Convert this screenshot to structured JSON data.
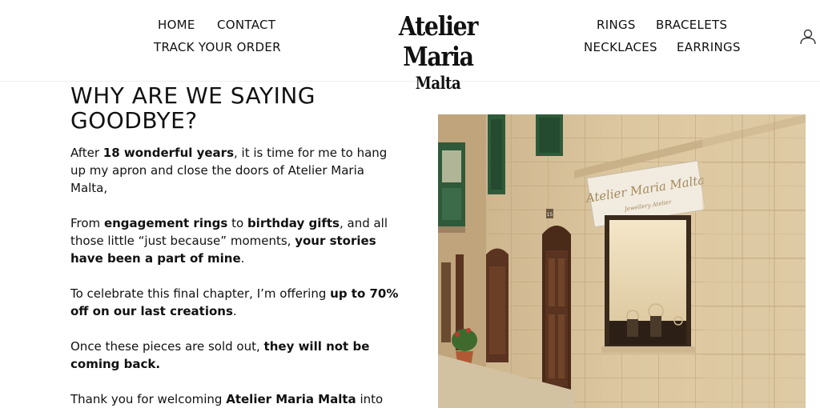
{
  "header": {
    "nav_left": [
      "HOME",
      "CONTACT",
      "TRACK YOUR ORDER"
    ],
    "logo_line1": "Atelier Maria",
    "logo_line2": "Malta",
    "nav_right": [
      "RINGS",
      "BRACELETS",
      "NECKLACES",
      "EARRINGS"
    ],
    "account_icon": "user-icon"
  },
  "main": {
    "heading_line1": "WHY ARE WE SAYING",
    "heading_line2": "GOODBYE?",
    "p1": [
      "After ",
      "18 wonderful years",
      ", it is time for me to hang up my apron and close the doors of Atelier Maria Malta,"
    ],
    "p2": [
      "From ",
      "engagement rings",
      " to ",
      "birthday gifts",
      ", and all those little “just because” moments, ",
      "your stories have been a part of mine",
      "."
    ],
    "p3": [
      "To celebrate this final chapter, I’m offering ",
      "up to 70% off on our last creations",
      "."
    ],
    "p4": [
      "Once these pieces are sold out, ",
      "they will not be coming back."
    ],
    "p5": [
      "Thank you for welcoming ",
      "Atelier Maria Malta",
      " into"
    ]
  },
  "photo": {
    "sign_line1": "Atelier Maria Malta",
    "sign_line2": "Jewellery Atelier",
    "house_number": "15"
  },
  "colors": {
    "text": "#111111",
    "stone": "#d8c39c",
    "shutter": "#2f5a3a",
    "door": "#5a3420"
  }
}
